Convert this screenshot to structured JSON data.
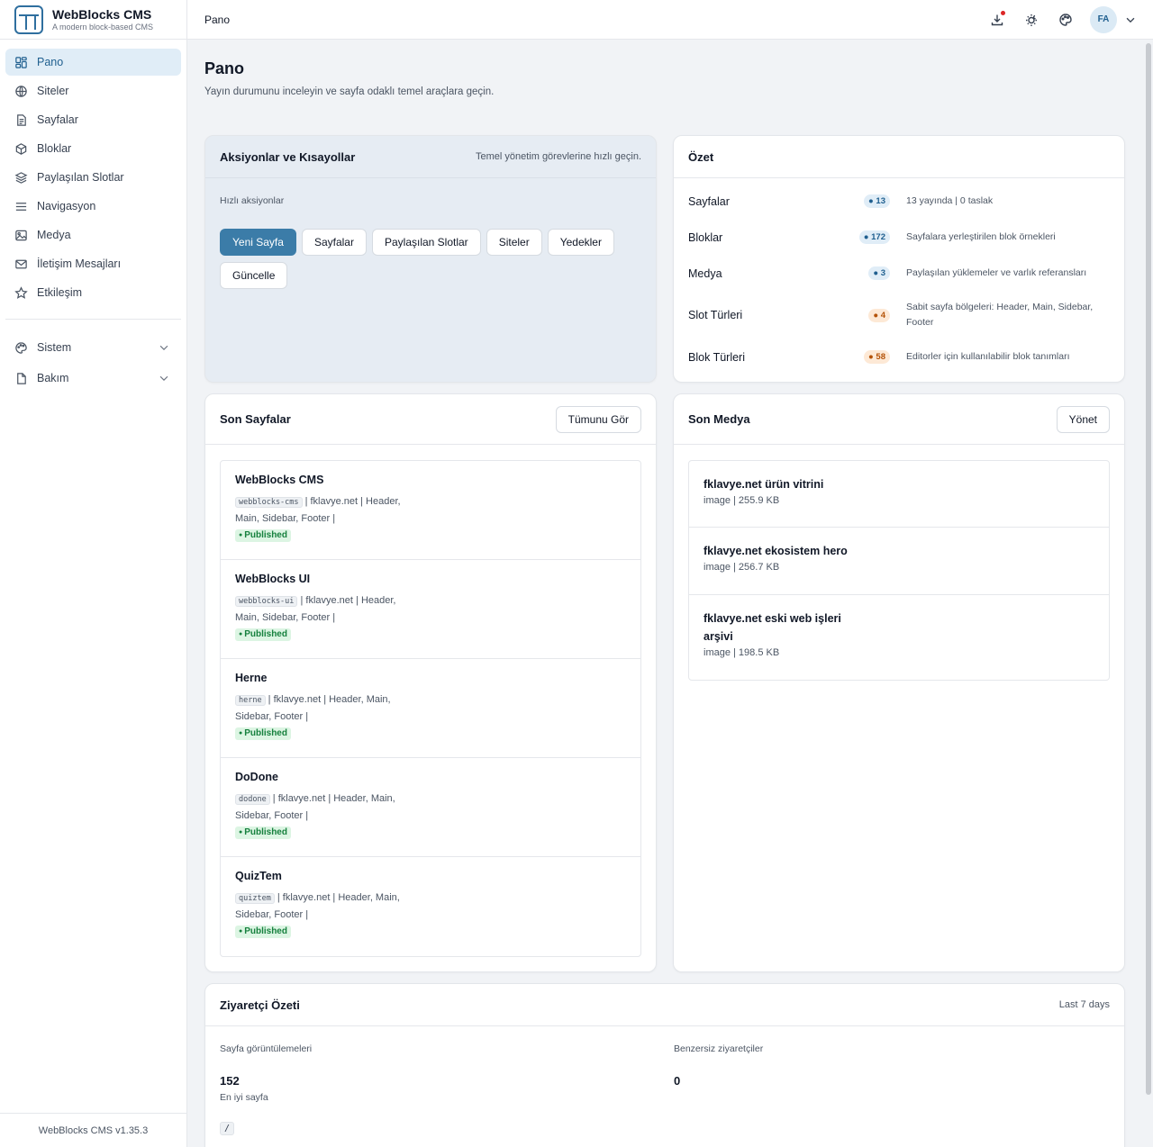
{
  "brand": {
    "title": "WebBlocks CMS",
    "subtitle": "A modern block-based CMS"
  },
  "sidebar": {
    "items": [
      {
        "label": "Pano",
        "icon": "dashboard-icon"
      },
      {
        "label": "Siteler",
        "icon": "globe-icon"
      },
      {
        "label": "Sayfalar",
        "icon": "document-icon"
      },
      {
        "label": "Bloklar",
        "icon": "cube-icon"
      },
      {
        "label": "Paylaşılan Slotlar",
        "icon": "layers-icon"
      },
      {
        "label": "Navigasyon",
        "icon": "menu-icon"
      },
      {
        "label": "Medya",
        "icon": "image-icon"
      },
      {
        "label": "İletişim Mesajları",
        "icon": "mail-icon"
      },
      {
        "label": "Etkileşim",
        "icon": "star-icon"
      }
    ],
    "groups": [
      {
        "label": "Sistem",
        "icon": "palette-icon"
      },
      {
        "label": "Bakım",
        "icon": "file-icon"
      }
    ],
    "footer": "WebBlocks CMS v1.35.3"
  },
  "topbar": {
    "breadcrumb": "Pano",
    "avatar": "FA"
  },
  "page": {
    "title": "Pano",
    "description": "Yayın durumunu inceleyin ve sayfa odaklı temel araçlara geçin."
  },
  "actions": {
    "title": "Aksiyonlar ve Kısayollar",
    "hint": "Temel yönetim görevlerine hızlı geçin.",
    "quick_label": "Hızlı aksiyonlar",
    "buttons": [
      "Yeni Sayfa",
      "Sayfalar",
      "Paylaşılan Slotlar",
      "Siteler",
      "Yedekler",
      "Güncelle"
    ]
  },
  "summary": {
    "title": "Özet",
    "rows": [
      {
        "label": "Sayfalar",
        "count": "● 13",
        "desc": "13 yayında | 0 taslak"
      },
      {
        "label": "Bloklar",
        "count": "● 172",
        "desc": "Sayfalara yerleştirilen blok örnekleri"
      },
      {
        "label": "Medya",
        "count": "● 3",
        "desc": "Paylaşılan yüklemeler ve varlık referansları"
      },
      {
        "label": "Slot Türleri",
        "count": "● 4",
        "desc": "Sabit sayfa bölgeleri: Header, Main, Sidebar, Footer"
      },
      {
        "label": "Blok Türleri",
        "count": "● 58",
        "desc": "Editorler için kullanılabilir blok tanımları"
      }
    ]
  },
  "recent_pages": {
    "title": "Son Sayfalar",
    "button": "Tümunu Gör",
    "items": [
      {
        "name": "WebBlocks CMS",
        "slug": "webblocks-cms",
        "meta": " | fklavye.net | Header, Main, Sidebar, Footer |",
        "status": "Published"
      },
      {
        "name": "WebBlocks UI",
        "slug": "webblocks-ui",
        "meta": " | fklavye.net | Header, Main, Sidebar, Footer |",
        "status": "Published"
      },
      {
        "name": "Herne",
        "slug": "herne",
        "meta": " | fklavye.net | Header, Main, Sidebar, Footer |",
        "status": "Published"
      },
      {
        "name": "DoDone",
        "slug": "dodone",
        "meta": " | fklavye.net | Header, Main, Sidebar, Footer |",
        "status": "Published"
      },
      {
        "name": "QuizTem",
        "slug": "quiztem",
        "meta": " | fklavye.net | Header, Main, Sidebar, Footer |",
        "status": "Published"
      }
    ]
  },
  "recent_media": {
    "title": "Son Medya",
    "button": "Yönet",
    "items": [
      {
        "name": "fklavye.net ürün vitrini",
        "meta": "image | 255.9 KB"
      },
      {
        "name": "fklavye.net ekosistem hero",
        "meta": "image | 256.7 KB"
      },
      {
        "name": "fklavye.net eski web işleri arşivi",
        "meta": "image | 198.5 KB"
      }
    ]
  },
  "visitors": {
    "title": "Ziyaretçi Özeti",
    "range": "Last 7 days",
    "views_label": "Sayfa görüntülemeleri",
    "views_value": "152",
    "unique_label": "Benzersiz ziyaretçiler",
    "unique_value": "0",
    "top_page_label": "En iyi sayfa",
    "top_page": "/"
  },
  "colors": {
    "accent": "#3b7ca8",
    "active_bg": "#e0edf7",
    "published": "#15803d"
  }
}
